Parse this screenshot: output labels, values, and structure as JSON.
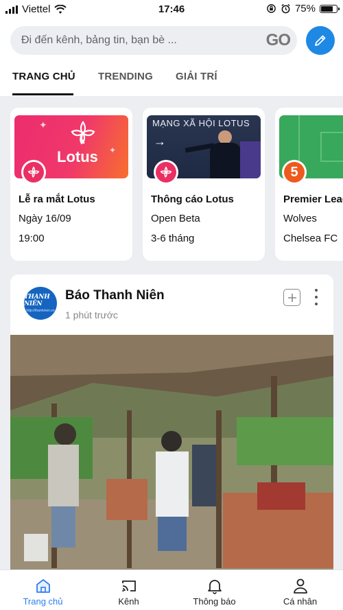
{
  "status_bar": {
    "carrier": "Viettel",
    "time": "17:46",
    "battery": "75%",
    "battery_level": 0.75
  },
  "search": {
    "placeholder": "Đi đến kênh, bảng tin, bạn bè ...",
    "go_label": "GO"
  },
  "compose_icon": "pencil-icon",
  "tabs": [
    {
      "label": "TRANG CHỦ",
      "active": true
    },
    {
      "label": "TRENDING",
      "active": false
    },
    {
      "label": "GIẢI TRÍ",
      "active": false
    }
  ],
  "cards": [
    {
      "title": "Lễ ra mắt Lotus",
      "line1": "Ngày 16/09",
      "line2": "19:00",
      "thumb_text": "Lotus"
    },
    {
      "title": "Thông cáo Lotus",
      "line1": "Open Beta",
      "line2": "3-6 tháng",
      "thumb_text": "MẠNG XÃ HỘI LOTUS"
    },
    {
      "title": "Premier League",
      "line1": "Wolves",
      "line2": "Chelsea FC",
      "thumb_text": "5"
    }
  ],
  "post": {
    "source": "Báo Thanh Niên",
    "time": "1 phút trước",
    "avatar_text": "THANH NIÊN",
    "avatar_subtext": "http://thanhnien.vn"
  },
  "bottom_nav": [
    {
      "label": "Trang chủ",
      "icon": "home-icon",
      "active": true
    },
    {
      "label": "Kênh",
      "icon": "cast-icon",
      "active": false
    },
    {
      "label": "Thông báo",
      "icon": "bell-icon",
      "active": false
    },
    {
      "label": "Cá nhân",
      "icon": "person-icon",
      "active": false
    }
  ],
  "colors": {
    "accent": "#1e88e5",
    "lotus_pink": "#ea2f63",
    "active_nav": "#2d7ef0"
  }
}
